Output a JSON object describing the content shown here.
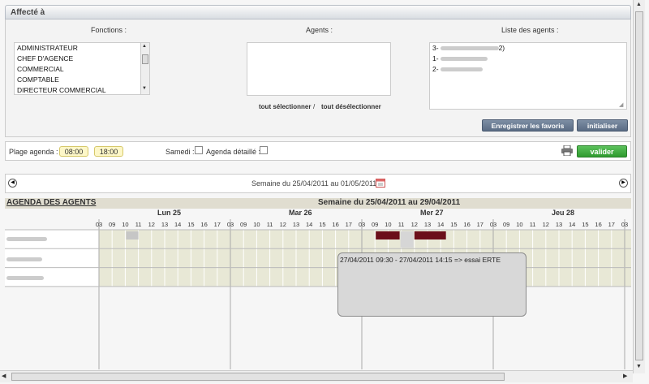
{
  "affecte": {
    "title": "Affecté à",
    "fonctions_label": "Fonctions :",
    "agents_label": "Agents :",
    "liste_label": "Liste des agents :",
    "fonctions": [
      "ADMINISTRATEUR",
      "CHEF D'AGENCE",
      "COMMERCIAL",
      "COMPTABLE",
      "DIRECTEUR COMMERCIAL"
    ],
    "liste_agents": [
      "3-",
      "1-",
      "2-"
    ],
    "liste_agents_suffix": "2)",
    "tout_selectionner": "tout sélectionner",
    "separator": "/",
    "tout_deselectionner": "tout désélectionner",
    "enregistrer": "Enregistrer les favoris",
    "initialiser": "initialiser"
  },
  "plage": {
    "label": "Plage agenda :",
    "start": "08:00",
    "end": "18:00",
    "samedi": "Samedi :",
    "agenda_detaille": "Agenda détaillé :",
    "valider": "valider"
  },
  "semaine_nav": "Semaine du 25/04/2011 au 01/05/2011",
  "agenda": {
    "title": "AGENDA DES AGENTS",
    "semaine": "Semaine du 25/04/2011 au 29/04/2011",
    "days": [
      "Lun 25",
      "Mar 26",
      "Mer 27",
      "Jeu 28"
    ],
    "hours": [
      "03",
      "09",
      "10",
      "11",
      "12",
      "13",
      "14",
      "15",
      "16",
      "17"
    ],
    "tooltip": "27/04/2011 09:30 - 27/04/2011 14:15 => essai ERTE",
    "colors": {
      "grid_bg": "#e8e8d6",
      "header_bg": "#e0ddd0",
      "event": "#6b0f1a",
      "slot": "#c6c6c6"
    }
  },
  "icons": [
    "printer-icon",
    "calendar-icon",
    "chevron-left-icon",
    "chevron-right-icon"
  ]
}
